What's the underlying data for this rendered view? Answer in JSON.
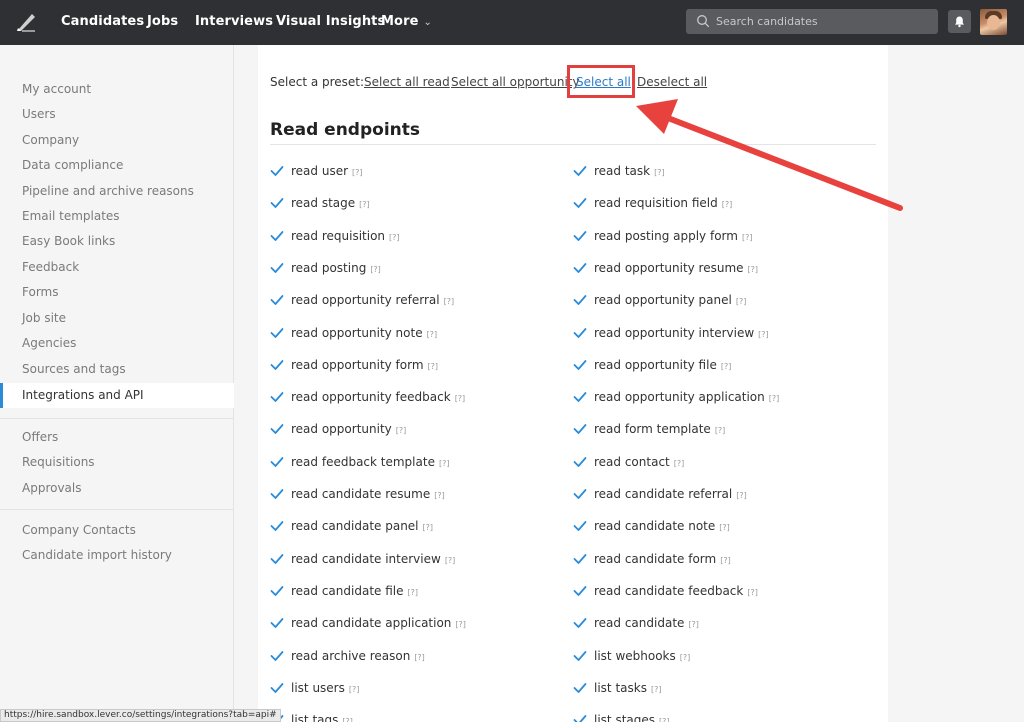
{
  "topbar": {
    "nav": [
      "Candidates",
      "Jobs",
      "Interviews",
      "Visual Insights",
      "More"
    ],
    "search_placeholder": "Search candidates"
  },
  "sidebar": {
    "group1": [
      "My account",
      "Users",
      "Company",
      "Data compliance",
      "Pipeline and archive reasons",
      "Email templates",
      "Easy Book links",
      "Feedback",
      "Forms",
      "Job site",
      "Agencies",
      "Sources and tags"
    ],
    "active": "Integrations and API",
    "group2": [
      "Offers",
      "Requisitions",
      "Approvals"
    ],
    "group3": [
      "Company Contacts",
      "Candidate import history"
    ]
  },
  "presets": {
    "label": "Select a preset:",
    "links": [
      "Select all read",
      "Select all opportunity",
      "Select all",
      "Deselect all"
    ]
  },
  "section": {
    "title": "Read endpoints",
    "help": "[?]"
  },
  "left_items": [
    "read user",
    "read stage",
    "read requisition",
    "read posting",
    "read opportunity referral",
    "read opportunity note",
    "read opportunity form",
    "read opportunity feedback",
    "read opportunity",
    "read feedback template",
    "read candidate resume",
    "read candidate panel",
    "read candidate interview",
    "read candidate file",
    "read candidate application",
    "read archive reason",
    "list users",
    "list tags"
  ],
  "right_items": [
    "read task",
    "read requisition field",
    "read posting apply form",
    "read opportunity resume",
    "read opportunity panel",
    "read opportunity interview",
    "read opportunity file",
    "read opportunity application",
    "read form template",
    "read contact",
    "read candidate referral",
    "read candidate note",
    "read candidate form",
    "read candidate feedback",
    "read candidate",
    "list webhooks",
    "list tasks",
    "list stages"
  ],
  "status_url": "https://hire.sandbox.lever.co/settings/integrations?tab=api#",
  "colors": {
    "accent": "#2a8bd8",
    "highlight": "#e2403f",
    "topbar": "#2f3033"
  }
}
